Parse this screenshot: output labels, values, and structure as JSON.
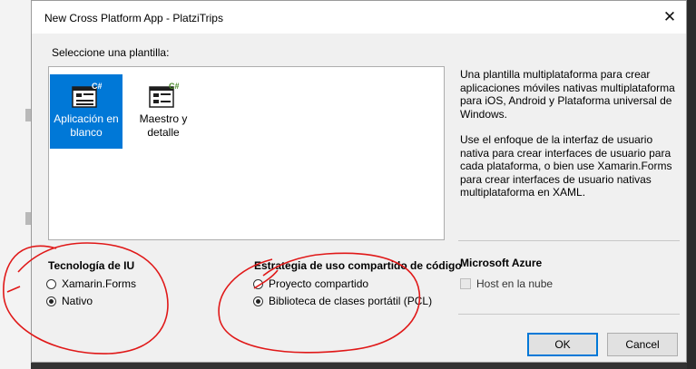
{
  "window": {
    "title": "New Cross Platform App - PlatziTrips",
    "close_glyph": "✕"
  },
  "templates_heading": "Seleccione una plantilla:",
  "templates": [
    {
      "label": "Aplicación en blanco",
      "selected": true,
      "icon": "blank-app-icon"
    },
    {
      "label": "Maestro y detalle",
      "selected": false,
      "icon": "master-detail-icon"
    }
  ],
  "description": {
    "paragraph1": "Una plantilla multiplataforma para crear aplicaciones móviles nativas multiplataforma para iOS, Android y Plataforma universal de Windows.",
    "paragraph2": "Use el enfoque de la interfaz de usuario nativa para crear interfaces de usuario para cada plataforma, o bien use Xamarin.Forms para crear interfaces de usuario nativas multiplataforma en XAML."
  },
  "ui_tech": {
    "title": "Tecnología de IU",
    "options": [
      {
        "label": "Xamarin.Forms",
        "checked": false
      },
      {
        "label": "Nativo",
        "checked": true
      }
    ]
  },
  "sharing": {
    "title": "Estrategia de uso compartido de código",
    "options": [
      {
        "label": "Proyecto compartido",
        "checked": false
      },
      {
        "label": "Biblioteca de clases portátil (PCL)",
        "checked": true
      }
    ]
  },
  "azure": {
    "title": "Microsoft Azure",
    "host_label": "Host en la nube",
    "host_checked": false,
    "host_enabled": false
  },
  "buttons": {
    "ok": "OK",
    "cancel": "Cancel"
  },
  "colors": {
    "selection": "#0078d7",
    "annotation": "#e01818"
  }
}
